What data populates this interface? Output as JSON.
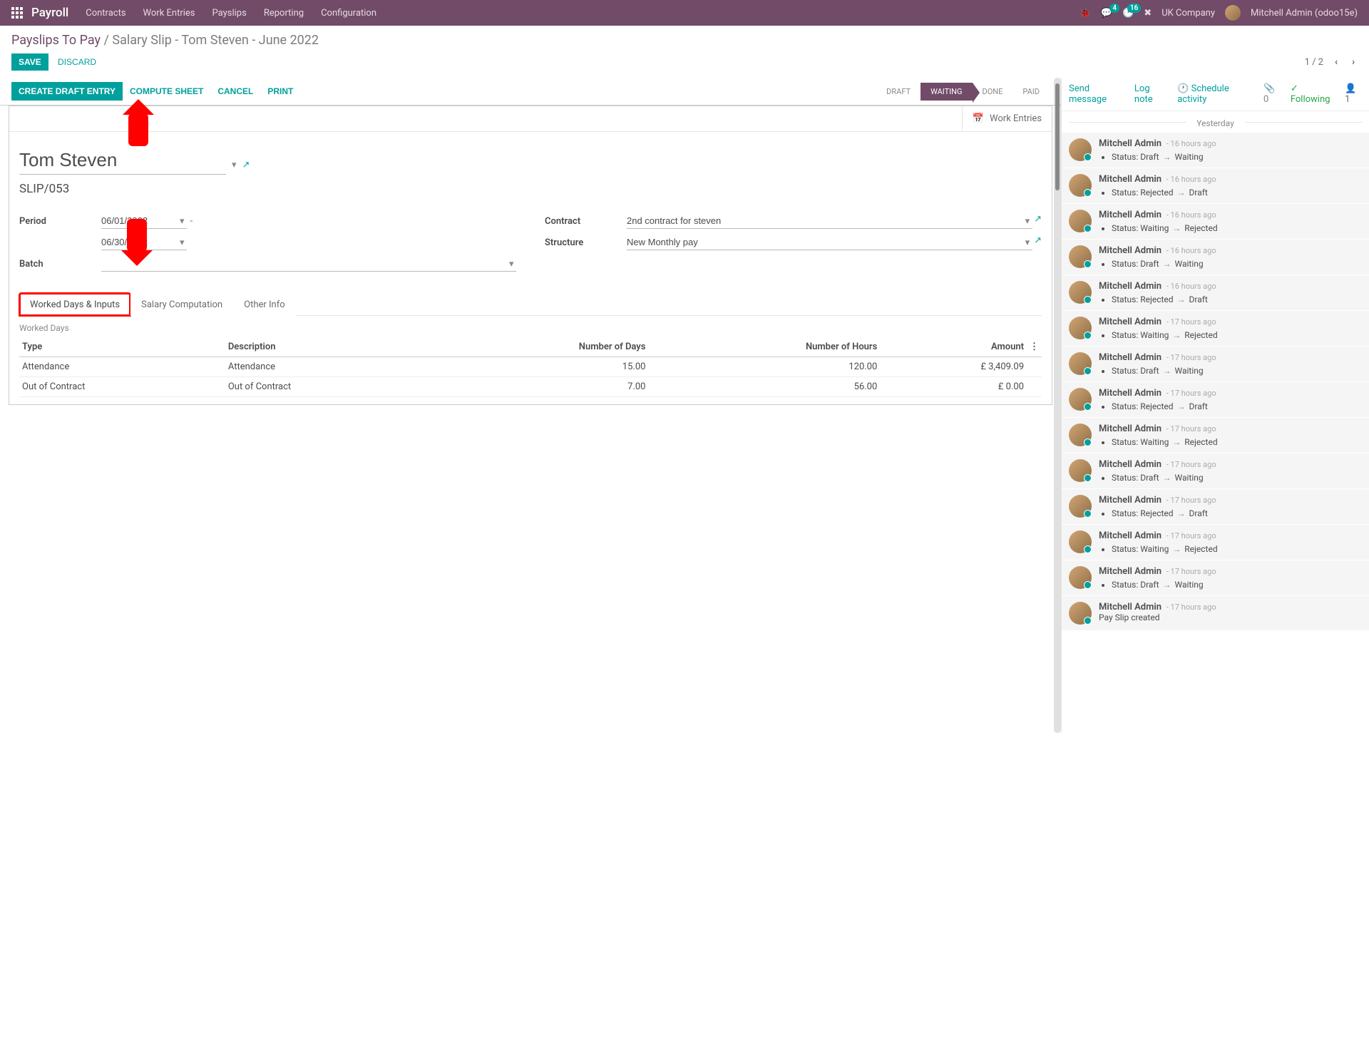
{
  "nav": {
    "brand": "Payroll",
    "menu": [
      "Contracts",
      "Work Entries",
      "Payslips",
      "Reporting",
      "Configuration"
    ],
    "badge_msg": "4",
    "badge_act": "16",
    "company": "UK Company",
    "user": "Mitchell Admin (odoo15e)"
  },
  "breadcrumb": {
    "parent": "Payslips To Pay",
    "sep": " / ",
    "current": "Salary Slip - Tom Steven - June 2022"
  },
  "actions": {
    "save": "SAVE",
    "discard": "DISCARD",
    "pager": "1 / 2"
  },
  "toolbar": {
    "create_draft": "CREATE DRAFT ENTRY",
    "compute": "COMPUTE SHEET",
    "cancel": "CANCEL",
    "print": "PRINT",
    "steps": [
      "DRAFT",
      "WAITING",
      "DONE",
      "PAID"
    ],
    "active_step": 1,
    "work_entries": "Work Entries"
  },
  "form": {
    "employee": "Tom Steven",
    "slip": "SLIP/053",
    "labels": {
      "period": "Period",
      "batch": "Batch",
      "contract": "Contract",
      "structure": "Structure"
    },
    "period_from": "06/01/2022",
    "period_to": "06/30/2022",
    "period_dash": "-",
    "batch": "",
    "contract": "2nd contract for steven",
    "structure": "New Monthly pay"
  },
  "tabs": {
    "wd": "Worked Days & Inputs",
    "sc": "Salary Computation",
    "oi": "Other Info",
    "section": "Worked Days",
    "headers": {
      "type": "Type",
      "desc": "Description",
      "days": "Number of Days",
      "hours": "Number of Hours",
      "amount": "Amount"
    },
    "rows": [
      {
        "type": "Attendance",
        "desc": "Attendance",
        "days": "15.00",
        "hours": "120.00",
        "amount": "£ 3,409.09"
      },
      {
        "type": "Out of Contract",
        "desc": "Out of Contract",
        "days": "7.00",
        "hours": "56.00",
        "amount": "£ 0.00"
      }
    ]
  },
  "chatter": {
    "send": "Send message",
    "log": "Log note",
    "schedule": "Schedule activity",
    "attach": "0",
    "follow": "Following",
    "followers": "1",
    "date": "Yesterday",
    "author": "Mitchell Admin",
    "status_label": "Status:",
    "messages": [
      {
        "time": "16 hours ago",
        "from": "Draft",
        "to": "Waiting"
      },
      {
        "time": "16 hours ago",
        "from": "Rejected",
        "to": "Draft"
      },
      {
        "time": "16 hours ago",
        "from": "Waiting",
        "to": "Rejected"
      },
      {
        "time": "16 hours ago",
        "from": "Draft",
        "to": "Waiting"
      },
      {
        "time": "16 hours ago",
        "from": "Rejected",
        "to": "Draft"
      },
      {
        "time": "17 hours ago",
        "from": "Waiting",
        "to": "Rejected"
      },
      {
        "time": "17 hours ago",
        "from": "Draft",
        "to": "Waiting"
      },
      {
        "time": "17 hours ago",
        "from": "Rejected",
        "to": "Draft"
      },
      {
        "time": "17 hours ago",
        "from": "Waiting",
        "to": "Rejected"
      },
      {
        "time": "17 hours ago",
        "from": "Draft",
        "to": "Waiting"
      },
      {
        "time": "17 hours ago",
        "from": "Rejected",
        "to": "Draft"
      },
      {
        "time": "17 hours ago",
        "from": "Waiting",
        "to": "Rejected"
      },
      {
        "time": "17 hours ago",
        "from": "Draft",
        "to": "Waiting"
      }
    ],
    "last_msg": {
      "time": "17 hours ago",
      "text": "Pay Slip created"
    }
  }
}
